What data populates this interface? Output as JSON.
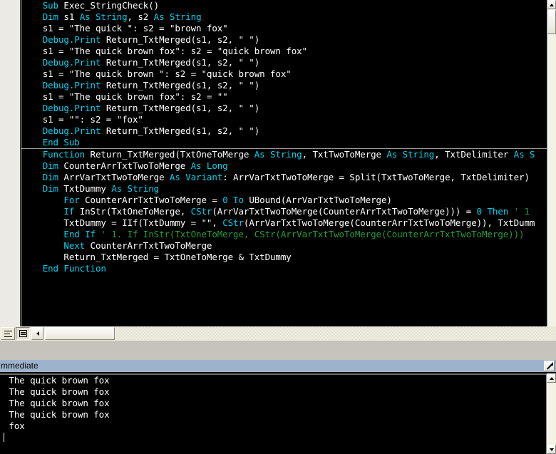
{
  "app": {
    "kind": "vba-editor",
    "colors": {
      "code_bg": "#000000",
      "keyword": "#00d2ef",
      "identifier": "#ffffff",
      "comment": "#1f9e3f",
      "titlebar": "#9db3cd",
      "chrome": "#ece9d8"
    }
  },
  "code_window": {
    "margin_strip_name": "indicator-margin",
    "lines": [
      {
        "indent": 1,
        "tokens": [
          {
            "t": "kw",
            "s": "Sub "
          },
          {
            "t": "id",
            "s": "Exec_StringCheck()"
          }
        ]
      },
      {
        "indent": 1,
        "tokens": [
          {
            "t": "kw",
            "s": "Dim "
          },
          {
            "t": "id",
            "s": "s1 "
          },
          {
            "t": "kw",
            "s": "As String"
          },
          {
            "t": "id",
            "s": ", s2 "
          },
          {
            "t": "kw",
            "s": "As String"
          }
        ]
      },
      {
        "indent": 1,
        "tokens": [
          {
            "t": "id",
            "s": "s1 = \"The quick \": s2 = \"brown fox\""
          }
        ]
      },
      {
        "indent": 1,
        "tokens": [
          {
            "t": "kw",
            "s": "Debug.Print "
          },
          {
            "t": "id",
            "s": "Return_TxtMerged(s1, s2, \" \")"
          }
        ]
      },
      {
        "indent": 1,
        "tokens": [
          {
            "t": "id",
            "s": "s1 = \"The quick brown fox\": s2 = \"quick brown fox\""
          }
        ]
      },
      {
        "indent": 1,
        "tokens": [
          {
            "t": "kw",
            "s": "Debug.Print "
          },
          {
            "t": "id",
            "s": "Return_TxtMerged(s1, s2, \" \")"
          }
        ]
      },
      {
        "indent": 1,
        "tokens": [
          {
            "t": "id",
            "s": "s1 = \"The quick brown \": s2 = \"quick brown fox\""
          }
        ]
      },
      {
        "indent": 1,
        "tokens": [
          {
            "t": "kw",
            "s": "Debug.Print "
          },
          {
            "t": "id",
            "s": "Return_TxtMerged(s1, s2, \" \")"
          }
        ]
      },
      {
        "indent": 1,
        "tokens": [
          {
            "t": "id",
            "s": "s1 = \"The quick brown fox\": s2 = \"\""
          }
        ]
      },
      {
        "indent": 1,
        "tokens": [
          {
            "t": "kw",
            "s": "Debug.Print "
          },
          {
            "t": "id",
            "s": "Return_TxtMerged(s1, s2, \" \")"
          }
        ]
      },
      {
        "indent": 1,
        "tokens": [
          {
            "t": "id",
            "s": "s1 = \"\": s2 = \"fox\""
          }
        ]
      },
      {
        "indent": 1,
        "tokens": [
          {
            "t": "kw",
            "s": "Debug.Print "
          },
          {
            "t": "id",
            "s": "Return_TxtMerged(s1, s2, \" \")"
          }
        ]
      },
      {
        "indent": 1,
        "tokens": [
          {
            "t": "kw",
            "s": "End Sub"
          }
        ]
      },
      {
        "sep": true
      },
      {
        "indent": 1,
        "tokens": [
          {
            "t": "kw",
            "s": "Function "
          },
          {
            "t": "id",
            "s": "Return_TxtMerged(TxtOneToMerge "
          },
          {
            "t": "kw",
            "s": "As String"
          },
          {
            "t": "id",
            "s": ", TxtTwoToMerge "
          },
          {
            "t": "kw",
            "s": "As String"
          },
          {
            "t": "id",
            "s": ", TxtDelimiter "
          },
          {
            "t": "kw",
            "s": "As S"
          }
        ]
      },
      {
        "indent": 1,
        "tokens": [
          {
            "t": "kw",
            "s": "Dim "
          },
          {
            "t": "id",
            "s": "CounterArrTxtTwoToMerge "
          },
          {
            "t": "kw",
            "s": "As Long"
          }
        ]
      },
      {
        "indent": 1,
        "tokens": [
          {
            "t": "kw",
            "s": "Dim "
          },
          {
            "t": "id",
            "s": "ArrVarTxtTwoToMerge "
          },
          {
            "t": "kw",
            "s": "As Variant"
          },
          {
            "t": "id",
            "s": ": ArrVarTxtTwoToMerge = Split(TxtTwoToMerge, TxtDelimiter)"
          }
        ]
      },
      {
        "indent": 1,
        "tokens": [
          {
            "t": "kw",
            "s": "Dim "
          },
          {
            "t": "id",
            "s": "TxtDummy "
          },
          {
            "t": "kw",
            "s": "As String"
          }
        ]
      },
      {
        "indent": 2,
        "tokens": [
          {
            "t": "kw",
            "s": "For "
          },
          {
            "t": "id",
            "s": "CounterArrTxtTwoToMerge = "
          },
          {
            "t": "kw",
            "s": "0 To "
          },
          {
            "t": "id",
            "s": "UBound(ArrVarTxtTwoToMerge)"
          }
        ]
      },
      {
        "indent": 2,
        "tokens": [
          {
            "t": "kw",
            "s": "If "
          },
          {
            "t": "id",
            "s": "InStr(TxtOneToMerge, "
          },
          {
            "t": "kw",
            "s": "CStr"
          },
          {
            "t": "id",
            "s": "(ArrVarTxtTwoToMerge(CounterArrTxtTwoToMerge))) = "
          },
          {
            "t": "kw",
            "s": "0 Then "
          },
          {
            "t": "cmt",
            "s": "' 1"
          }
        ]
      },
      {
        "indent": 2,
        "tokens": [
          {
            "t": "id",
            "s": "TxtDummy = IIf(TxtDummy = \"\", "
          },
          {
            "t": "kw",
            "s": "CStr"
          },
          {
            "t": "id",
            "s": "(ArrVarTxtTwoToMerge(CounterArrTxtTwoToMerge)), TxtDumm"
          }
        ]
      },
      {
        "indent": 2,
        "tokens": [
          {
            "t": "kw",
            "s": "End If "
          },
          {
            "t": "cmt",
            "s": "' 1. If InStr(TxtOneToMerge, CStr(ArrVarTxtTwoToMerge(CounterArrTxtTwoToMerge))) "
          }
        ]
      },
      {
        "indent": 2,
        "tokens": [
          {
            "t": "kw",
            "s": "Next "
          },
          {
            "t": "id",
            "s": "CounterArrTxtTwoToMerge"
          }
        ]
      },
      {
        "indent": 2,
        "tokens": [
          {
            "t": "id",
            "s": "Return_TxtMerged = TxtOneToMerge & TxtDummy"
          }
        ]
      },
      {
        "indent": 1,
        "tokens": [
          {
            "t": "kw",
            "s": "End Function"
          }
        ]
      }
    ],
    "toolbar": {
      "procedure_view_label": "Procedure View",
      "full_module_view_label": "Full Module View"
    },
    "scrollbars": {
      "vertical_name": "code-vertical-scrollbar",
      "horizontal_name": "code-horizontal-scrollbar"
    }
  },
  "immediate_window": {
    "title": "mmediate",
    "close_icon": "diagonal-arrow-icon",
    "output_lines": [
      " The quick brown fox",
      " The quick brown fox",
      " The quick brown fox",
      " The quick brown fox",
      " fox"
    ]
  }
}
